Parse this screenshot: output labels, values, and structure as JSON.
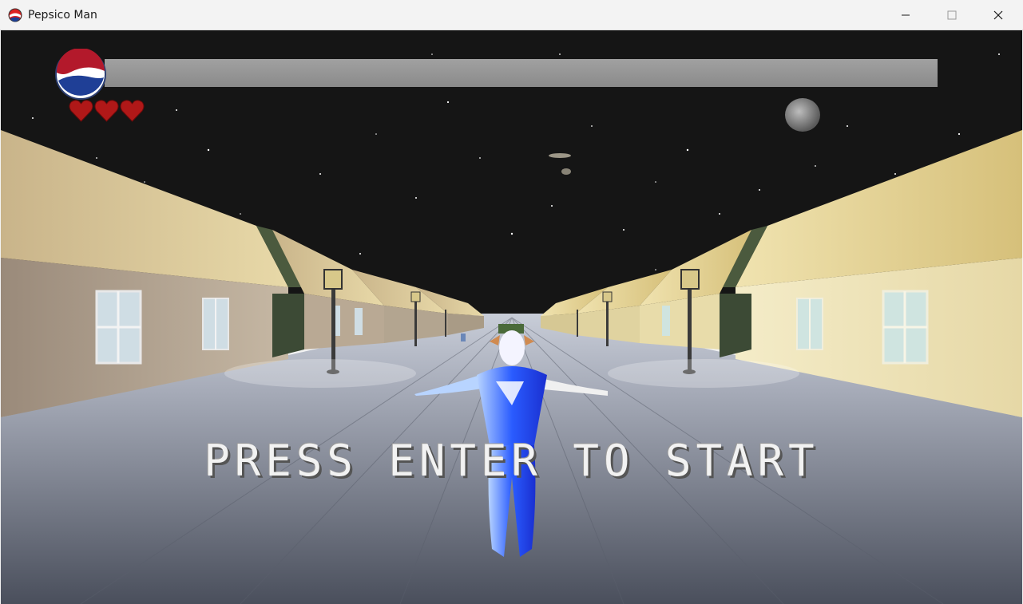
{
  "window": {
    "title": "Pepsico Man",
    "icons": [
      "app-icon",
      "minimize-icon",
      "maximize-icon",
      "close-icon"
    ]
  },
  "hud": {
    "logo_icon": "pepsi-logo-icon",
    "progress_fraction": 0,
    "lives": 3,
    "heart_color": "#b01818"
  },
  "game": {
    "prompt": "PRESS ENTER TO START"
  },
  "colors": {
    "sky": "#111111",
    "road": "#8d93a3",
    "player_blue": "#2255ff"
  }
}
